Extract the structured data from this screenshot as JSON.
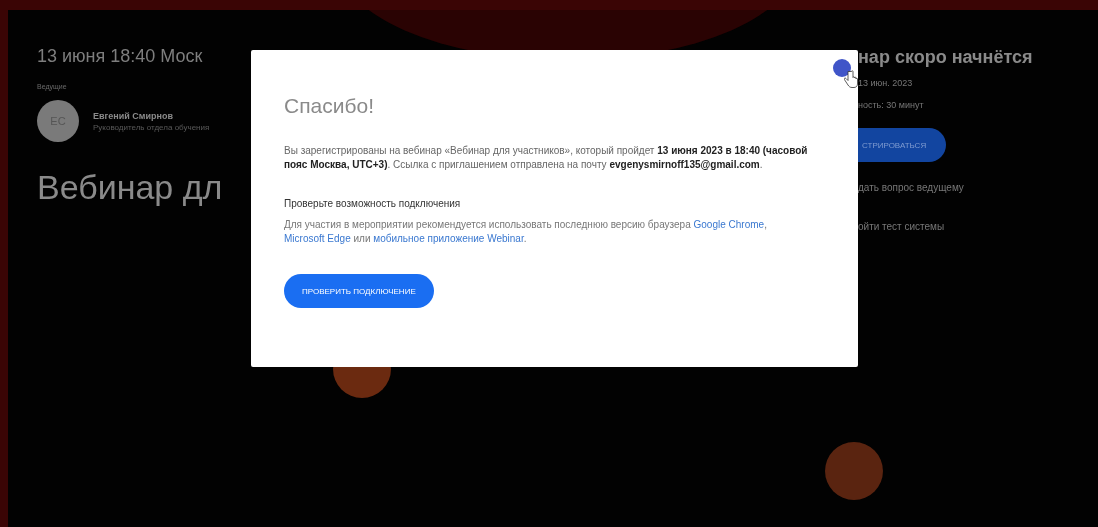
{
  "page": {
    "date": "13 июня 18:40 Моск",
    "hosts_label": "Ведущие",
    "host": {
      "initials": "ЕС",
      "name": "Евгений Смирнов",
      "role": "Руководитель отдела обучения"
    },
    "title": "Вебинар дл"
  },
  "sidebar": {
    "heading": "нар скоро начнётся",
    "date": "13 июн. 2023",
    "duration": "ность: 30 минут",
    "register_button": "СТРИРОВАТЬСЯ",
    "links": [
      "дать вопрос ведущему",
      "ойти тест системы"
    ]
  },
  "modal": {
    "title": "Спасибо!",
    "message": "Вы зарегистрированы на вебинар «Вебинар для участников», который пройдет **13 июня 2023 в 18:40 (часовой пояс Москва, UTC+3)**. Ссылка с приглашением отправлена на почту **evgenysmirnoff135@gmail.com**.",
    "check_heading": "Проверьте возможность подключения",
    "check_text": [
      {
        "kind": "text",
        "text": "Для участия в мероприятии рекомендуется использовать последнюю версию браузера "
      },
      {
        "kind": "link",
        "text": "Google Chrome"
      },
      {
        "kind": "text",
        "text": ", "
      },
      {
        "kind": "link",
        "text": "Microsoft Edge"
      },
      {
        "kind": "text",
        "text": " или "
      },
      {
        "kind": "link",
        "text": "мобильное приложение Webinar"
      },
      {
        "kind": "text",
        "text": "."
      }
    ],
    "check_button": "ПРОВЕРИТЬ ПОДКЛЮЧЕНИЕ"
  }
}
